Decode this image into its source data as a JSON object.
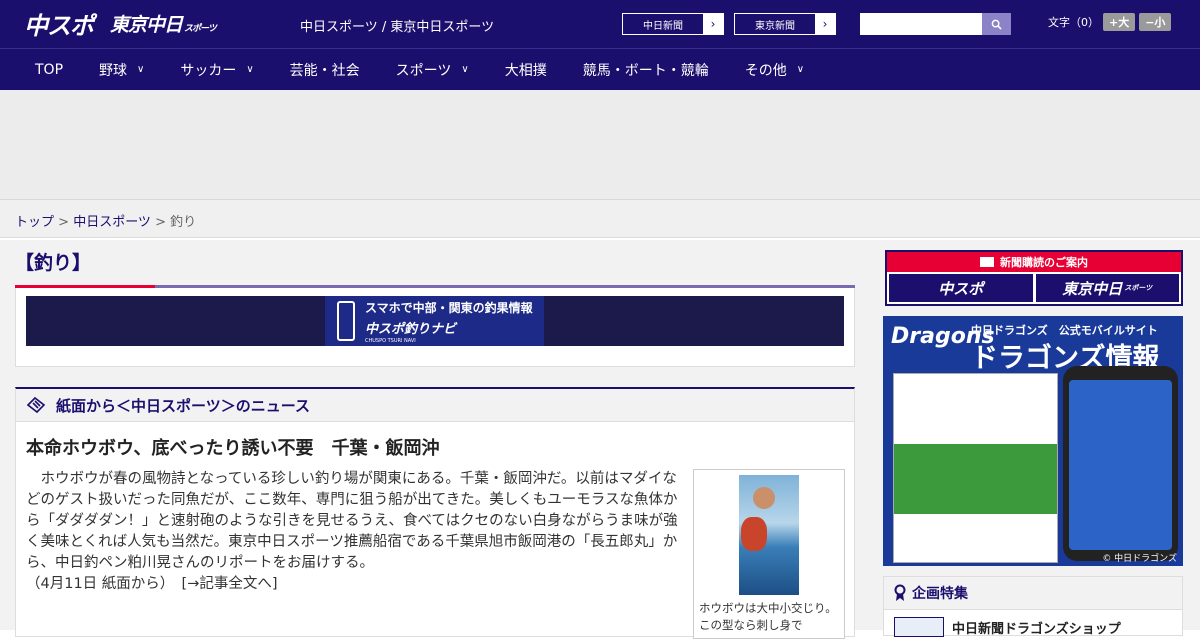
{
  "header": {
    "logo_chuspo": "中スポ",
    "logo_tokyo": "東京中日",
    "logo_tokyo_small": "スポーツ",
    "site_desc": "中日スポーツ / 東京中日スポーツ",
    "btn_chunichi": "中日新聞",
    "btn_tokyo": "東京新聞",
    "search_placeholder": "",
    "font_label": "文字（0）",
    "font_large": "+大",
    "font_small": "−小"
  },
  "nav": {
    "items": [
      {
        "label": "TOP"
      },
      {
        "label": "野球"
      },
      {
        "label": "サッカー"
      },
      {
        "label": "芸能・社会"
      },
      {
        "label": "スポーツ"
      },
      {
        "label": "大相撲"
      },
      {
        "label": "競馬・ボート・競輪"
      },
      {
        "label": "その他"
      }
    ]
  },
  "breadcrumb": {
    "home": "トップ",
    "sep1": " > ",
    "section": "中日スポーツ",
    "sep2": " > ",
    "current": "釣り"
  },
  "main": {
    "section_title": "【釣り】",
    "banner": {
      "line1": "スマホで中部・関東の釣果情報",
      "line2": "中スポ釣りナビ",
      "line3": "CHUSPO TSURI NAVI"
    },
    "news": {
      "header": "紙面から＜中日スポーツ＞のニュース",
      "article_title": "本命ホウボウ、底べったり誘い不要　千葉・飯岡沖",
      "article_body": "　ホウボウが春の風物詩となっている珍しい釣り場が関東にある。千葉・飯岡沖だ。以前はマダイなどのゲスト扱いだった同魚だが、ここ数年、専門に狙う船が出てきた。美しくもユーモラスな魚体から「ダダダダン！」と速射砲のような引きを見せるうえ、食べてはクセのない白身ながらうま味が強く美味とくれば人気も当然だ。東京中日スポーツ推薦船宿である千葉県旭市飯岡港の「長五郎丸」から、中日釣ペン粕川晃さんのリポートをお届けする。",
      "article_meta": "（4月11日 紙面から）　[→記事全文へ]",
      "photo_caption": "ホウボウは大中小交じり。この型なら刺し身で"
    }
  },
  "sidebar": {
    "subscribe_head": "新聞購読のご案内",
    "sub_logo1": "中スポ",
    "sub_logo2": "東京中日",
    "sub_logo2_small": "スポーツ",
    "dragons_logo": "Dragons",
    "dragons_sub": "中日ドラゴンズ　公式モバイルサイト",
    "dragons_big": "ドラゴンズ情報",
    "dragons_copy": "© 中日ドラゴンズ",
    "kikaku_title": "企画特集",
    "kikaku_item": "中日新聞ドラゴンズショップ"
  },
  "colors": {
    "brand_navy": "#1b0f6e",
    "accent_red": "#e60033",
    "accent_purple": "#7a6ab0"
  }
}
